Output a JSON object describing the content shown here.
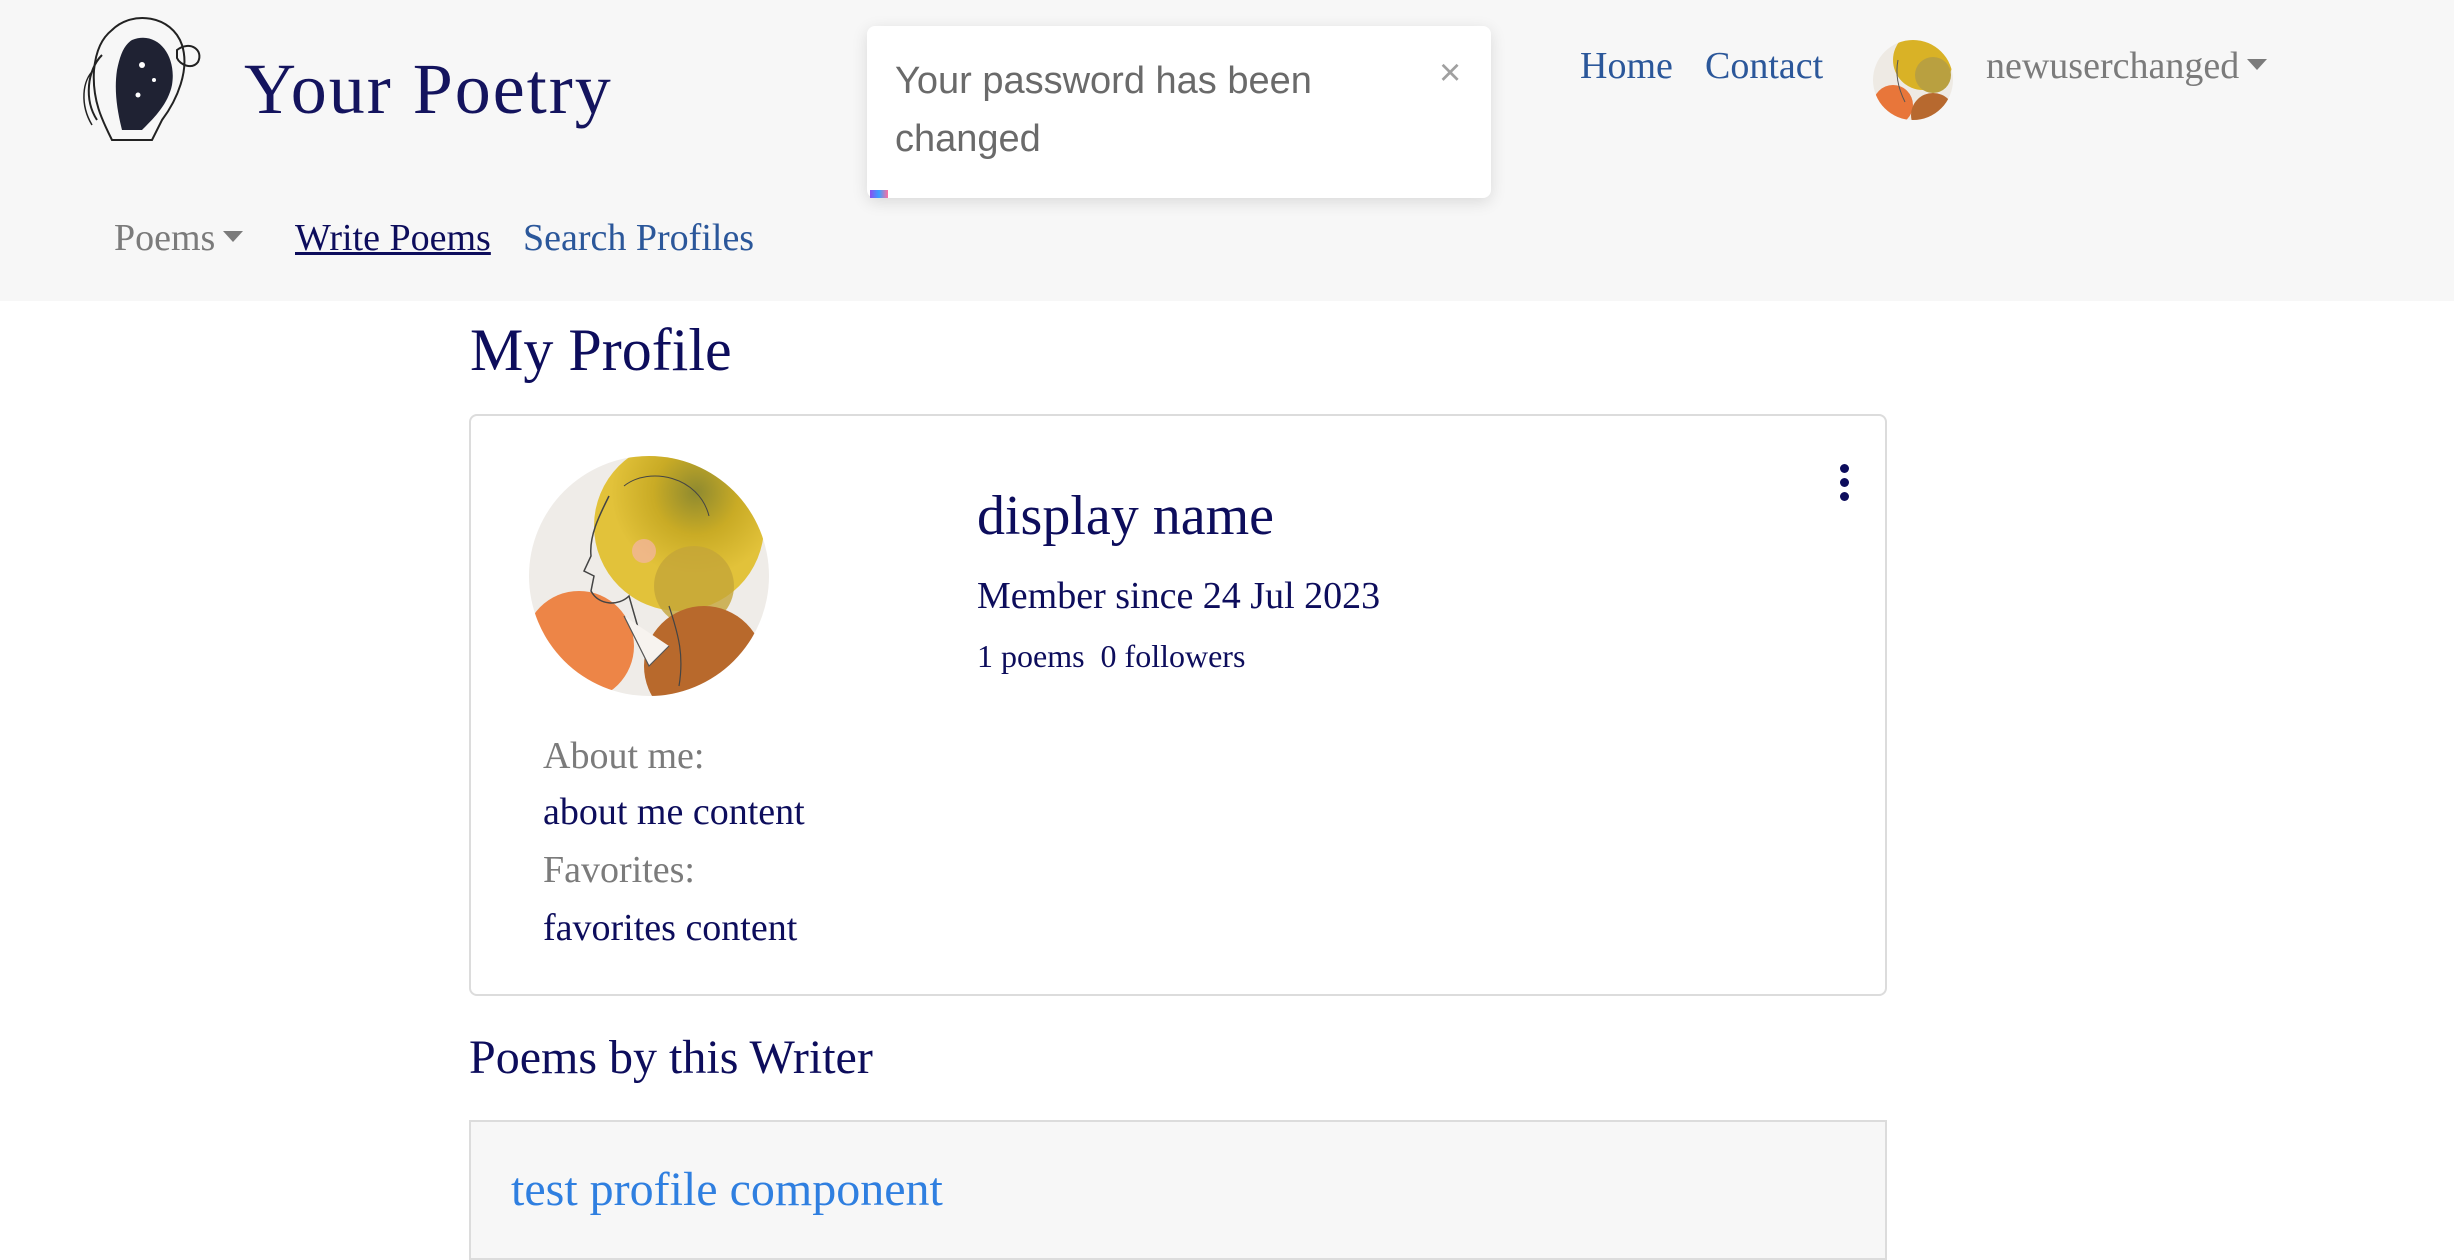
{
  "brand": {
    "title": "Your Poetry"
  },
  "top_nav": {
    "home": "Home",
    "contact": "Contact"
  },
  "user_menu": {
    "username": "newuserchanged"
  },
  "sub_nav": {
    "poems": "Poems",
    "write": "Write Poems",
    "search": "Search Profiles"
  },
  "toast": {
    "message": "Your password has been changed",
    "close": "×"
  },
  "profile": {
    "page_title": "My Profile",
    "display_name": "display name",
    "member_since": "Member since 24 Jul 2023",
    "poems_count": "1 poems",
    "followers_count": "0 followers",
    "about_label": "About me:",
    "about_value": "about me content",
    "favorites_label": "Favorites:",
    "favorites_value": "favorites content"
  },
  "poems_section": {
    "title": "Poems by this Writer",
    "items": [
      {
        "title": "test profile component"
      }
    ]
  },
  "colors": {
    "brand_navy": "#0d0d5c",
    "link_blue": "#2b579a",
    "poem_link": "#2f7fe0",
    "muted_gray": "#7b7b7b",
    "header_bg": "#f7f7f7"
  },
  "icons": {
    "logo": "woman-profile-line-art-logo",
    "avatar": "watercolor-woman-portrait",
    "menu": "vertical-ellipsis-icon",
    "dropdown": "caret-down-icon",
    "close": "close-icon"
  }
}
